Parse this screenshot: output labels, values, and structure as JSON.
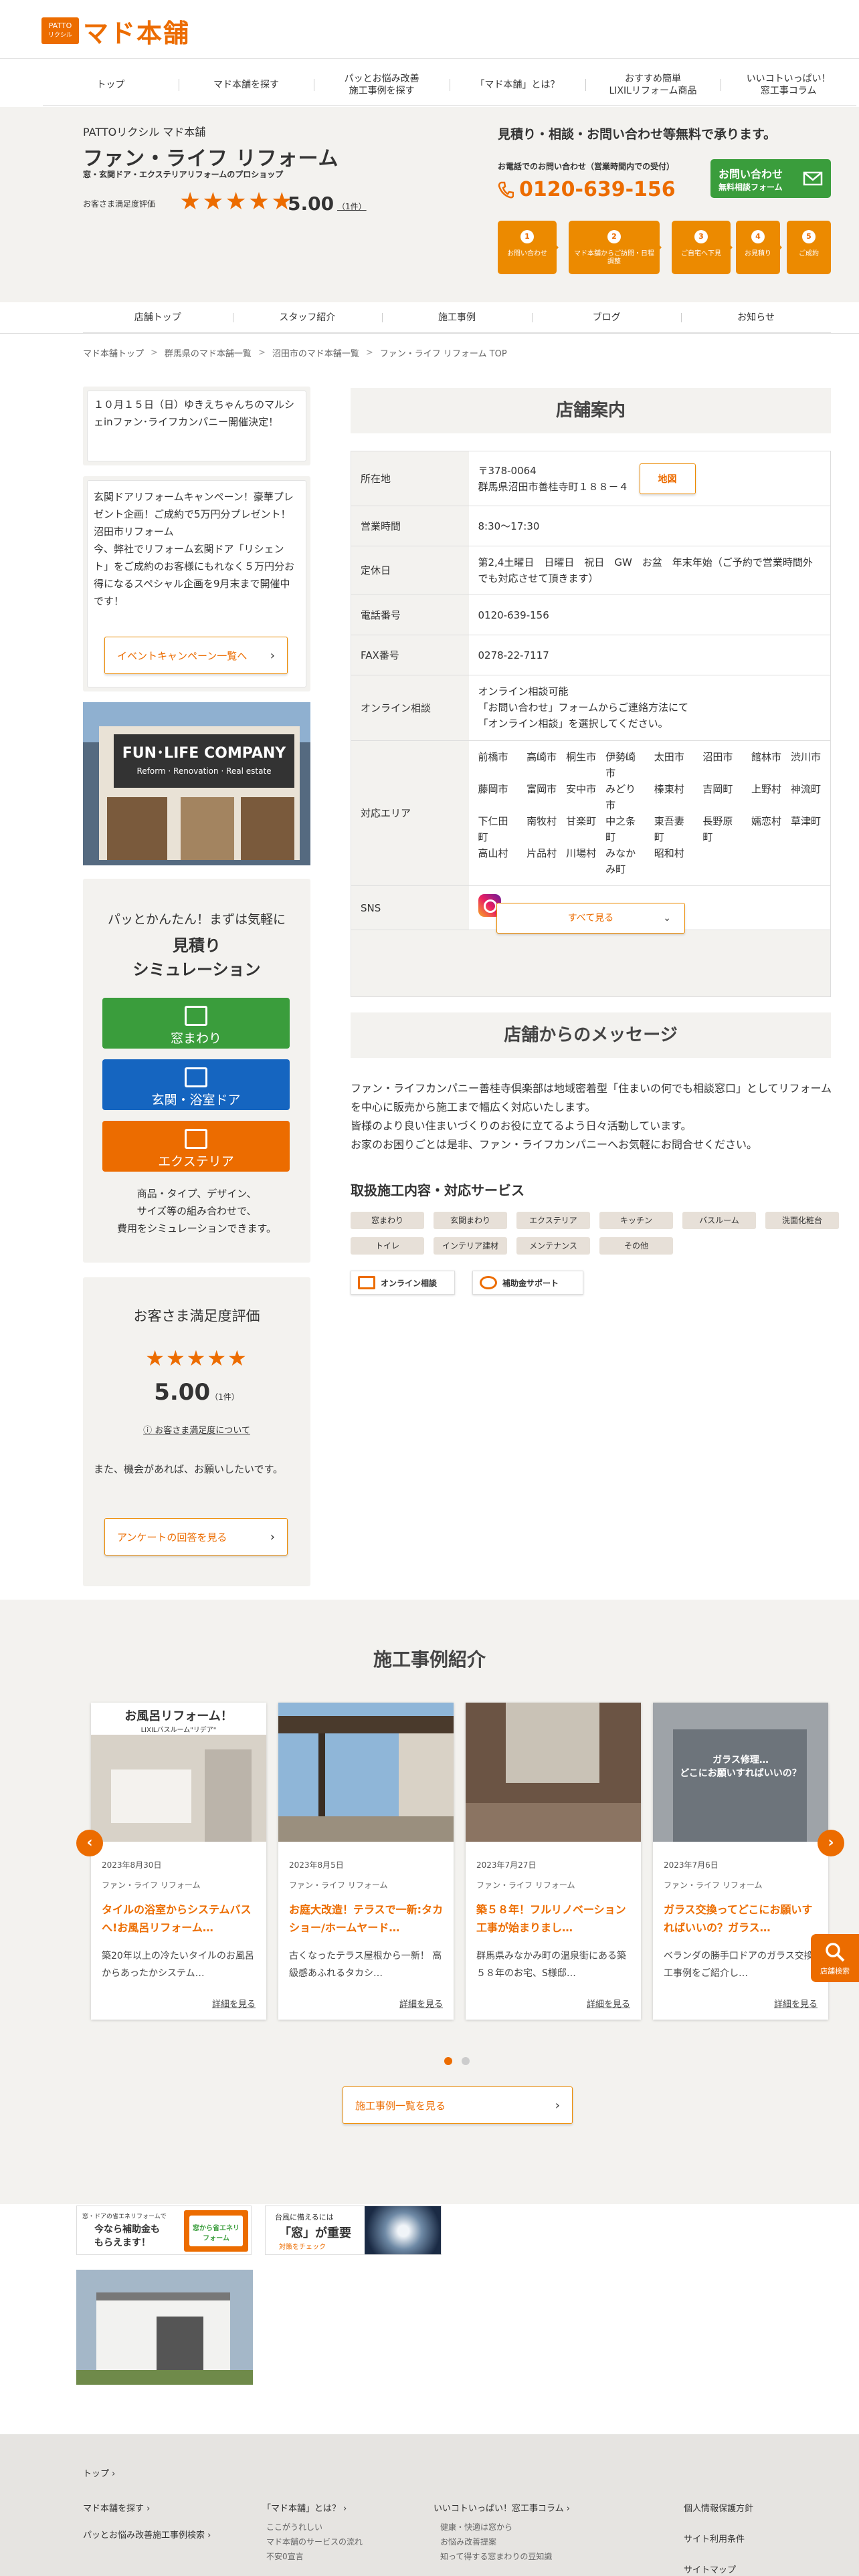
{
  "logo": {
    "badge_line1": "PATTO",
    "badge_line2": "リクシル",
    "text": "マド本舗"
  },
  "global_nav": [
    "トップ",
    "マド本舗を探す",
    "パッとお悩み改善\n施工事例を探す",
    "「マド本舗」とは？",
    "おすすめ簡単\nLIXILリフォーム商品",
    "いいコトいっぱい！\n窓工事コラム"
  ],
  "shop": {
    "kicker": "PATTOリクシル マド本舗",
    "name": "ファン・ライフ リフォーム",
    "tagline": "窓・玄関ドア・エクステリアリフォームのプロショップ",
    "rating_label": "お客さま満足度評価",
    "stars": "★★★★★",
    "rating": "5.00",
    "rating_count": "（1件）"
  },
  "contact": {
    "free_text": "見積り・相談・お問い合わせ等無料で承ります。",
    "tel_label": "お電話でのお問い合わせ（営業時間内での受付）",
    "tel": "0120-639-156",
    "button_line1": "お問い合わせ",
    "button_line2": "無料相談フォーム",
    "steps": [
      {
        "num": "1",
        "label": "お問い合わせ"
      },
      {
        "num": "2",
        "label": "マド本舗からご訪問・日程調整"
      },
      {
        "num": "3",
        "label": "ご自宅へ下見"
      },
      {
        "num": "4",
        "label": "お見積り"
      },
      {
        "num": "5",
        "label": "ご成約"
      }
    ]
  },
  "shop_nav": [
    "店舗トップ",
    "スタッフ紹介",
    "施工事例",
    "ブログ",
    "お知らせ"
  ],
  "breadcrumb": [
    "マド本舗トップ",
    "群馬県のマド本舗一覧",
    "沼田市のマド本舗一覧",
    "ファン・ライフ リフォーム TOP"
  ],
  "sidebar": {
    "news": "１０月１５日（日）ゆきえちゃんちのマルシェinファン･ライフカンパニー開催決定！",
    "promo": "玄関ドアリフォームキャンペーン！豪華プレゼント企画！ご成約で5万円分プレゼント！沼田市リフォーム\n今、弊社でリフォーム玄関ドア「リシェント」をご成約のお客様にもれなく５万円分お得になるスペシャル企画を9月末まで開催中です！",
    "promo_button": "イベントキャンペーン一覧へ",
    "photo_sign": "FUN･LIFE COMPANY",
    "photo_sub": "Reform · Renovation · Real estate",
    "sim_intro": "パッとかんたん！まずは気軽に",
    "sim_title_1": "見積り",
    "sim_title_2": "シミュレーション",
    "sim_buttons": [
      {
        "label": "窓まわり",
        "color": "#3a9d3c"
      },
      {
        "label": "玄関・浴室ドア",
        "color": "#1565c0"
      },
      {
        "label": "エクステリア",
        "color": "#ec6c00"
      }
    ],
    "sim_note": "商品・タイプ、デザイン、\nサイズ等の組み合わせで、\n費用をシミュレーションできます。",
    "eval_title": "お客さま満足度評価",
    "eval_stars": "★★★★★",
    "eval_value": "5.00",
    "eval_count": "（1件）",
    "eval_link": "お客さま満足度について",
    "eval_note": "また、機会があれば、お願いしたいです。",
    "eval_button": "アンケートの回答を見る"
  },
  "store_info": {
    "heading": "店舗案内",
    "rows": [
      {
        "key": "所在地",
        "value": "〒378-0064\n群馬県沼田市善桂寺町１８８－４"
      },
      {
        "key": "営業時間",
        "value": "8:30〜17:30"
      },
      {
        "key": "定休日",
        "value": "第2,4土曜日　日曜日　祝日　GW　お盆　年末年始（ご予約で営業時間外でも対応させて頂きます）"
      },
      {
        "key": "電話番号",
        "value": "0120-639-156"
      },
      {
        "key": "FAX番号",
        "value": "0278-22-7117"
      },
      {
        "key": "オンライン相談",
        "value": "オンライン相談可能\n「お問い合わせ」フォームからご連絡方法にて\n「オンライン相談」を選択してください。"
      },
      {
        "key": "対応エリア",
        "value": ""
      },
      {
        "key": "SNS",
        "value": ""
      }
    ],
    "map_button": "地図",
    "areas": [
      "前橋市",
      "高崎市",
      "桐生市",
      "伊勢崎市",
      "太田市",
      "沼田市",
      "館林市",
      "渋川市",
      "藤岡市",
      "富岡市",
      "安中市",
      "みどり市",
      "榛東村",
      "吉岡町",
      "上野村",
      "神流町",
      "下仁田町",
      "南牧村",
      "甘楽町",
      "中之条町",
      "東吾妻町",
      "長野原町",
      "嬬恋村",
      "草津町",
      "高山村",
      "片品村",
      "川場村",
      "みなかみ町",
      "昭和村"
    ],
    "more_button": "すべて見る"
  },
  "message": {
    "heading": "店舗からのメッセージ",
    "text": "ファン・ライフカンパニー善桂寺倶楽部は地域密着型「住まいの何でも相談窓口」としてリフォームを中心に販売から施工まで幅広く対応いたします。\n皆様のより良い住まいづくりのお役に立てるよう日々活動しています。\nお家のお困りごとは是非、ファン・ライフカンパニーへお気軽にお問合せください。",
    "services_heading": "取扱施工内容・対応サービス",
    "tags": [
      "窓まわり",
      "玄関まわり",
      "エクステリア",
      "キッチン",
      "バスルーム",
      "洗面化粧台",
      "トイレ",
      "インテリア建材",
      "メンテナンス",
      "その他"
    ],
    "svc1": "オンライン相談",
    "svc2": "補助金サポート"
  },
  "cases": {
    "heading": "施工事例紹介",
    "items": [
      {
        "overlay": "お風呂リフォーム！",
        "overlay_sub": "LIXILバスルーム\"リデア\"",
        "date": "2023年8月30日",
        "company": "ファン・ライフ リフォーム",
        "title": "タイルの浴室からシステムバスへ!お風呂リフォーム…",
        "desc": "築20年以上の冷たいタイルのお風呂からあったかシステム…",
        "link": "詳細を見る"
      },
      {
        "overlay": "",
        "overlay_sub": "",
        "date": "2023年8月5日",
        "company": "ファン・ライフ リフォーム",
        "title": "お庭大改造！テラスで一新:タカショー/ホームヤード…",
        "desc": "古くなったテラス屋根から一新！ 高級感あふれるタカシ…",
        "link": "詳細を見る"
      },
      {
        "overlay": "",
        "overlay_sub": "",
        "date": "2023年7月27日",
        "company": "ファン・ライフ リフォーム",
        "title": "築５８年！フルリノベーション工事が始まりまし…",
        "desc": "群馬県みなかみ町の温泉街にある築５８年のお宅、S様邸…",
        "link": "詳細を見る"
      },
      {
        "overlay": "ガラス修理…\nどこにお願いすればいいの？",
        "overlay_sub": "",
        "date": "2023年7月6日",
        "company": "ファン・ライフ リフォーム",
        "title": "ガラス交換ってどこにお願いすればいいの？ガラス…",
        "desc": "ベランダの勝手口ドアのガラス交換工事例をご紹介し…",
        "link": "詳細を見る"
      }
    ],
    "list_button": "施工事例一覧を見る"
  },
  "fab_label": "店舗検索",
  "banners": {
    "b1_text1": "窓・ドアの省エネリフォームで",
    "b1_text2": "今なら補助金も",
    "b1_text3": "もらえます！",
    "b1_badge": "窓から省エネリフォーム",
    "b2_text1": "台風に備えるには",
    "b2_text2": "「窓」が重要",
    "b2_text3": "対策をチェック"
  },
  "footer": {
    "top": "トップ",
    "col1": [
      "マド本舗を探す",
      "パッとお悩み改善施工事例検索"
    ],
    "col2_head": "「マド本舗」とは？",
    "col2_sub": [
      "ここがうれしい",
      "マド本舗のサービスの流れ",
      "不安0宣言"
    ],
    "col3_head": "いいコトいっぱい！窓工事コラム",
    "col3_sub": [
      "健康・快適は窓から",
      "お悩み改善提案",
      "知って得する窓まわりの豆知識"
    ],
    "col4": [
      "個人情報保護方針",
      "サイト利用条件",
      "サイトマップ"
    ]
  }
}
